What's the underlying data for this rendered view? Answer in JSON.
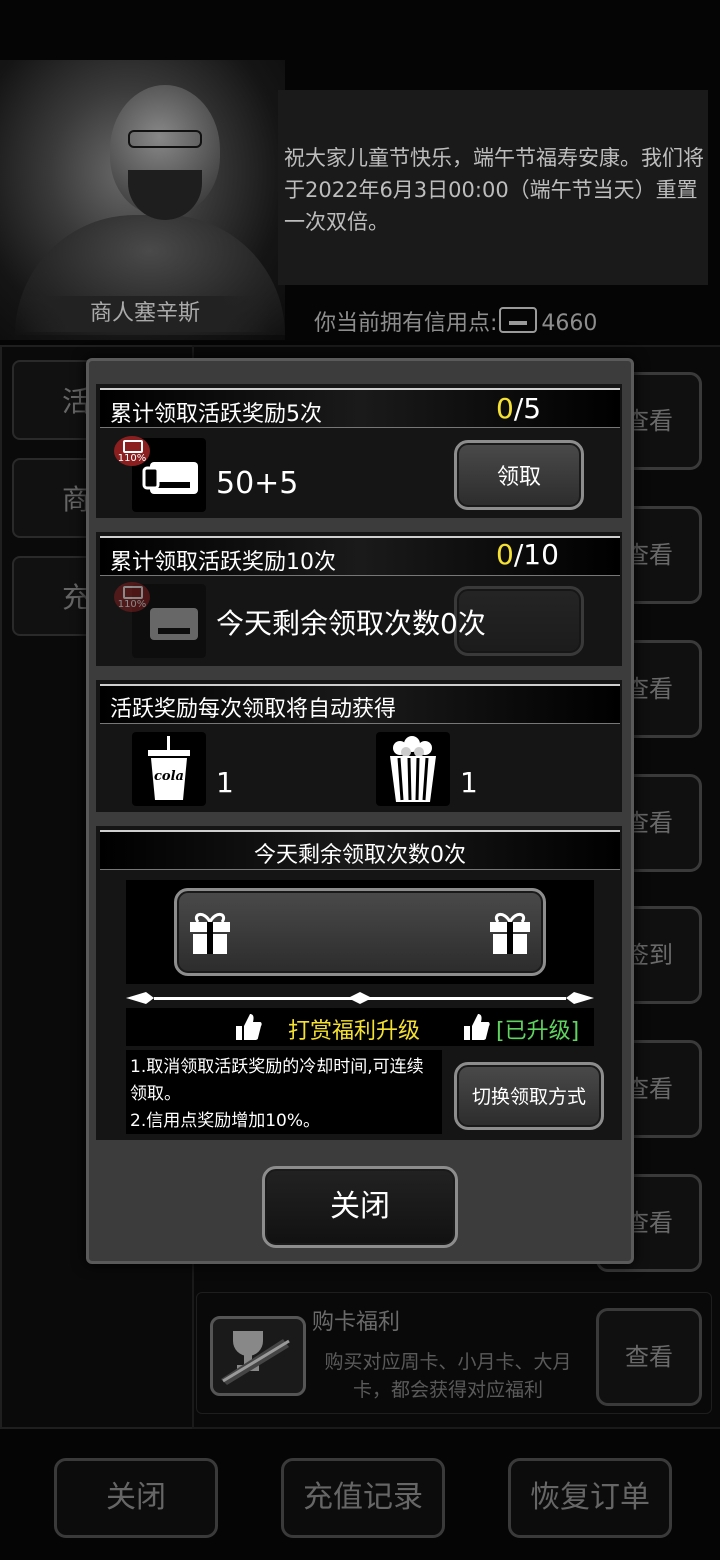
{
  "merchant": {
    "name": "商人塞辛斯",
    "message": "祝大家儿童节快乐，端午节福寿安康。我们将于2022年6月3日00:00（端午节当天）重置一次双倍。",
    "credit_label": "你当前拥有信用点:",
    "credit_value": "4660"
  },
  "left_tabs": [
    {
      "label": "活"
    },
    {
      "label": "商"
    },
    {
      "label": "充"
    }
  ],
  "right_buttons": [
    "查看",
    "查看",
    "查看",
    "查看",
    "签到",
    "查看",
    "查看",
    "查看"
  ],
  "card_welfare": {
    "title": "购卡福利",
    "desc": "购买对应周卡、小月卡、大月卡，都会获得对应福利",
    "button": "查看"
  },
  "bottom_buttons": {
    "close": "关闭",
    "recharge_record": "充值记录",
    "restore_order": "恢复订单"
  },
  "modal": {
    "reward1": {
      "title": "累计领取活跃奖励5次",
      "progress_current": "0",
      "progress_total": "/5",
      "badge": "110%",
      "amount": "50+5",
      "claim_button": "领取"
    },
    "reward2": {
      "title": "累计领取活跃奖励10次",
      "progress_current": "0",
      "progress_total": "/10",
      "badge": "110%",
      "overlay_text": "今天剩余领取次数0次"
    },
    "auto_reward": {
      "title": "活跃奖励每次领取将自动获得",
      "items": [
        {
          "icon": "cola-icon",
          "cola_text": "cola",
          "count": "1"
        },
        {
          "icon": "popcorn-icon",
          "count": "1"
        }
      ]
    },
    "remaining_label": "今天剩余领取次数0次",
    "upgrade": {
      "label": "打赏福利升级",
      "status": "[已升级]",
      "desc_line1": "1.取消领取活跃奖励的冷却时间,可连续领取。",
      "desc_line2": "2.信用点奖励增加10%。",
      "switch_button": "切换领取方式"
    },
    "close_button": "关闭"
  },
  "colors": {
    "accent_yellow": "#f5e131",
    "upgrade_green": "#5fd45f"
  }
}
